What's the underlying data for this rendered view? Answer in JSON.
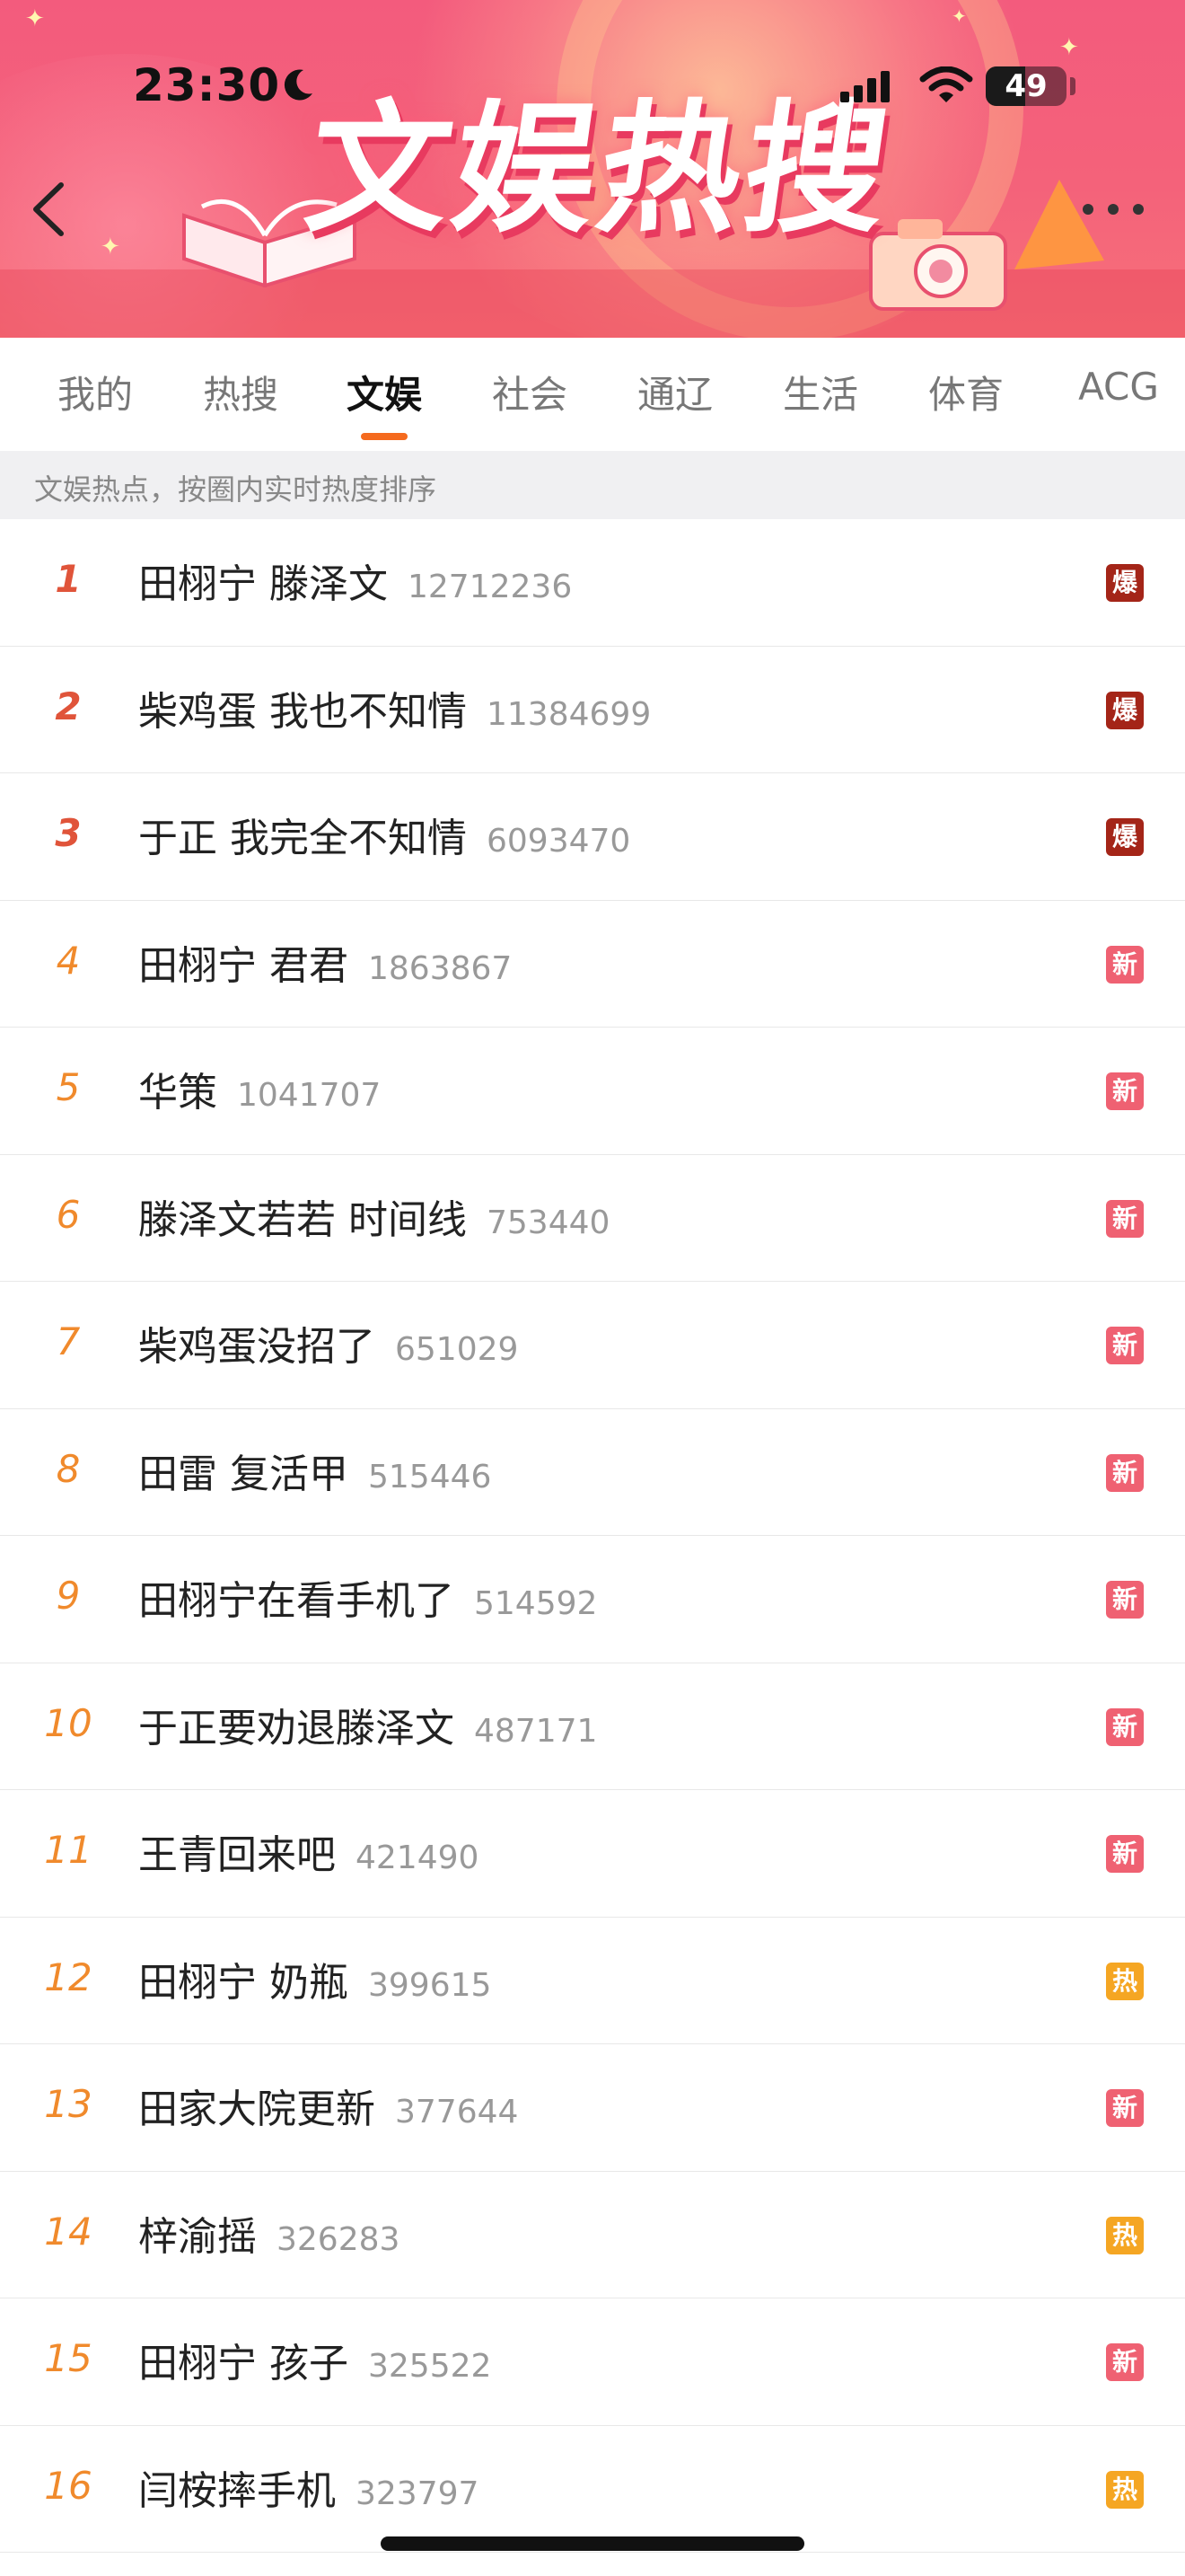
{
  "status_bar": {
    "time": "23:30",
    "battery": "49",
    "battery_level": 0.49
  },
  "banner": {
    "title": "文娱热搜"
  },
  "tabs": [
    "我的",
    "热搜",
    "文娱",
    "社会",
    "通辽",
    "生活",
    "体育",
    "ACG"
  ],
  "active_tab": "文娱",
  "notice": "文娱热点，按圈内实时热度排序",
  "badge_colors": {
    "爆": "#a42518",
    "新": "#ef6172",
    "热": "#f5a623"
  },
  "items": [
    {
      "rank": "1",
      "title": "田栩宁 滕泽文",
      "heat": "12712236",
      "badge": "爆"
    },
    {
      "rank": "2",
      "title": "柴鸡蛋 我也不知情",
      "heat": "11384699",
      "badge": "爆"
    },
    {
      "rank": "3",
      "title": "于正 我完全不知情",
      "heat": "6093470",
      "badge": "爆"
    },
    {
      "rank": "4",
      "title": "田栩宁 君君",
      "heat": "1863867",
      "badge": "新"
    },
    {
      "rank": "5",
      "title": "华策",
      "heat": "1041707",
      "badge": "新"
    },
    {
      "rank": "6",
      "title": "滕泽文若若 时间线",
      "heat": "753440",
      "badge": "新"
    },
    {
      "rank": "7",
      "title": "柴鸡蛋没招了",
      "heat": "651029",
      "badge": "新"
    },
    {
      "rank": "8",
      "title": "田雷 复活甲",
      "heat": "515446",
      "badge": "新"
    },
    {
      "rank": "9",
      "title": "田栩宁在看手机了",
      "heat": "514592",
      "badge": "新"
    },
    {
      "rank": "10",
      "title": "于正要劝退滕泽文",
      "heat": "487171",
      "badge": "新"
    },
    {
      "rank": "11",
      "title": "王青回来吧",
      "heat": "421490",
      "badge": "新"
    },
    {
      "rank": "12",
      "title": "田栩宁 奶瓶",
      "heat": "399615",
      "badge": "热"
    },
    {
      "rank": "13",
      "title": "田家大院更新",
      "heat": "377644",
      "badge": "新"
    },
    {
      "rank": "14",
      "title": "梓渝摇",
      "heat": "326283",
      "badge": "热"
    },
    {
      "rank": "15",
      "title": "田栩宁 孩子",
      "heat": "325522",
      "badge": "新"
    },
    {
      "rank": "16",
      "title": "闫桉摔手机",
      "heat": "323797",
      "badge": "热"
    }
  ]
}
